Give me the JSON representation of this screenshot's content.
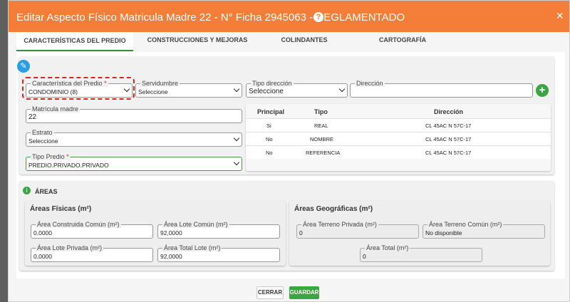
{
  "header": {
    "title": "Editar Aspecto Físico Matricula Madre 22 - N° Ficha 2945063 - REGLAMENTADO",
    "help": "?",
    "close": "×"
  },
  "tabs": [
    {
      "label": "CARACTERÍSTICAS DEL PREDIO"
    },
    {
      "label": "CONSTRUCCIONES Y MEJORAS"
    },
    {
      "label": "COLINDANTES"
    },
    {
      "label": "CARTOGRAFÍA"
    }
  ],
  "form": {
    "caracteristica_label": "Característica del Predio",
    "caracteristica_value": "CONDOMINIO (8)",
    "servidumbre_label": "Servidumbre",
    "servidumbre_value": "Seleccione",
    "tipo_direccion_label": "Tipo dirección",
    "tipo_direccion_value": "Seleccione",
    "direccion_label": "Dirección",
    "direccion_value": "",
    "matricula_label": "Matrícula madre",
    "matricula_value": "22",
    "estrato_label": "Estrato",
    "estrato_value": "Seleccione",
    "tipo_predio_label": "Tipo Predio",
    "tipo_predio_value": "PREDIO.PRIVADO.PRIVADO",
    "required_mark": "*"
  },
  "address_table": {
    "headers": [
      "Principal",
      "Tipo",
      "Dirección"
    ],
    "rows": [
      [
        "Si",
        "REAL",
        "CL 45AC N 57C-17"
      ],
      [
        "No",
        "NOMBRE",
        "CL 45AC N 57C-17"
      ],
      [
        "No",
        "REFERENCIA",
        "CL 45AC N 57C-17"
      ]
    ]
  },
  "areas": {
    "title": "ÁREAS",
    "info_icon": "i",
    "fisicas": {
      "title": "Áreas Físicas (m²)",
      "construida_label": "Área Construida Común (m²)",
      "construida_value": "0,0000",
      "lote_comun_label": "Área Lote Común (m²)",
      "lote_comun_value": "92,0000",
      "lote_privada_label": "Área Lote Privada (m²)",
      "lote_privada_value": "0,0000",
      "total_lote_label": "Área Total Lote (m²)",
      "total_lote_value": "92,0000"
    },
    "geograficas": {
      "title": "Áreas Geográficas (m²)",
      "terreno_privada_label": "Área Terreno Privada (m²)",
      "terreno_privada_value": "0",
      "terreno_comun_label": "Área Terreno Común (m²)",
      "terreno_comun_value": "No disponible",
      "total_label": "Área Total (m²)",
      "total_value": "0"
    }
  },
  "footer": {
    "cerrar": "CERRAR",
    "guardar": "GUARDAR"
  },
  "colors": {
    "header": "#f47d37",
    "accent_green": "#3aa643",
    "pencil_blue": "#2a9ee5",
    "highlight_red": "#d9261c"
  },
  "icons": [
    "help-icon",
    "close-icon",
    "pencil-icon",
    "add-icon",
    "info-icon",
    "chevron-down-icon"
  ]
}
